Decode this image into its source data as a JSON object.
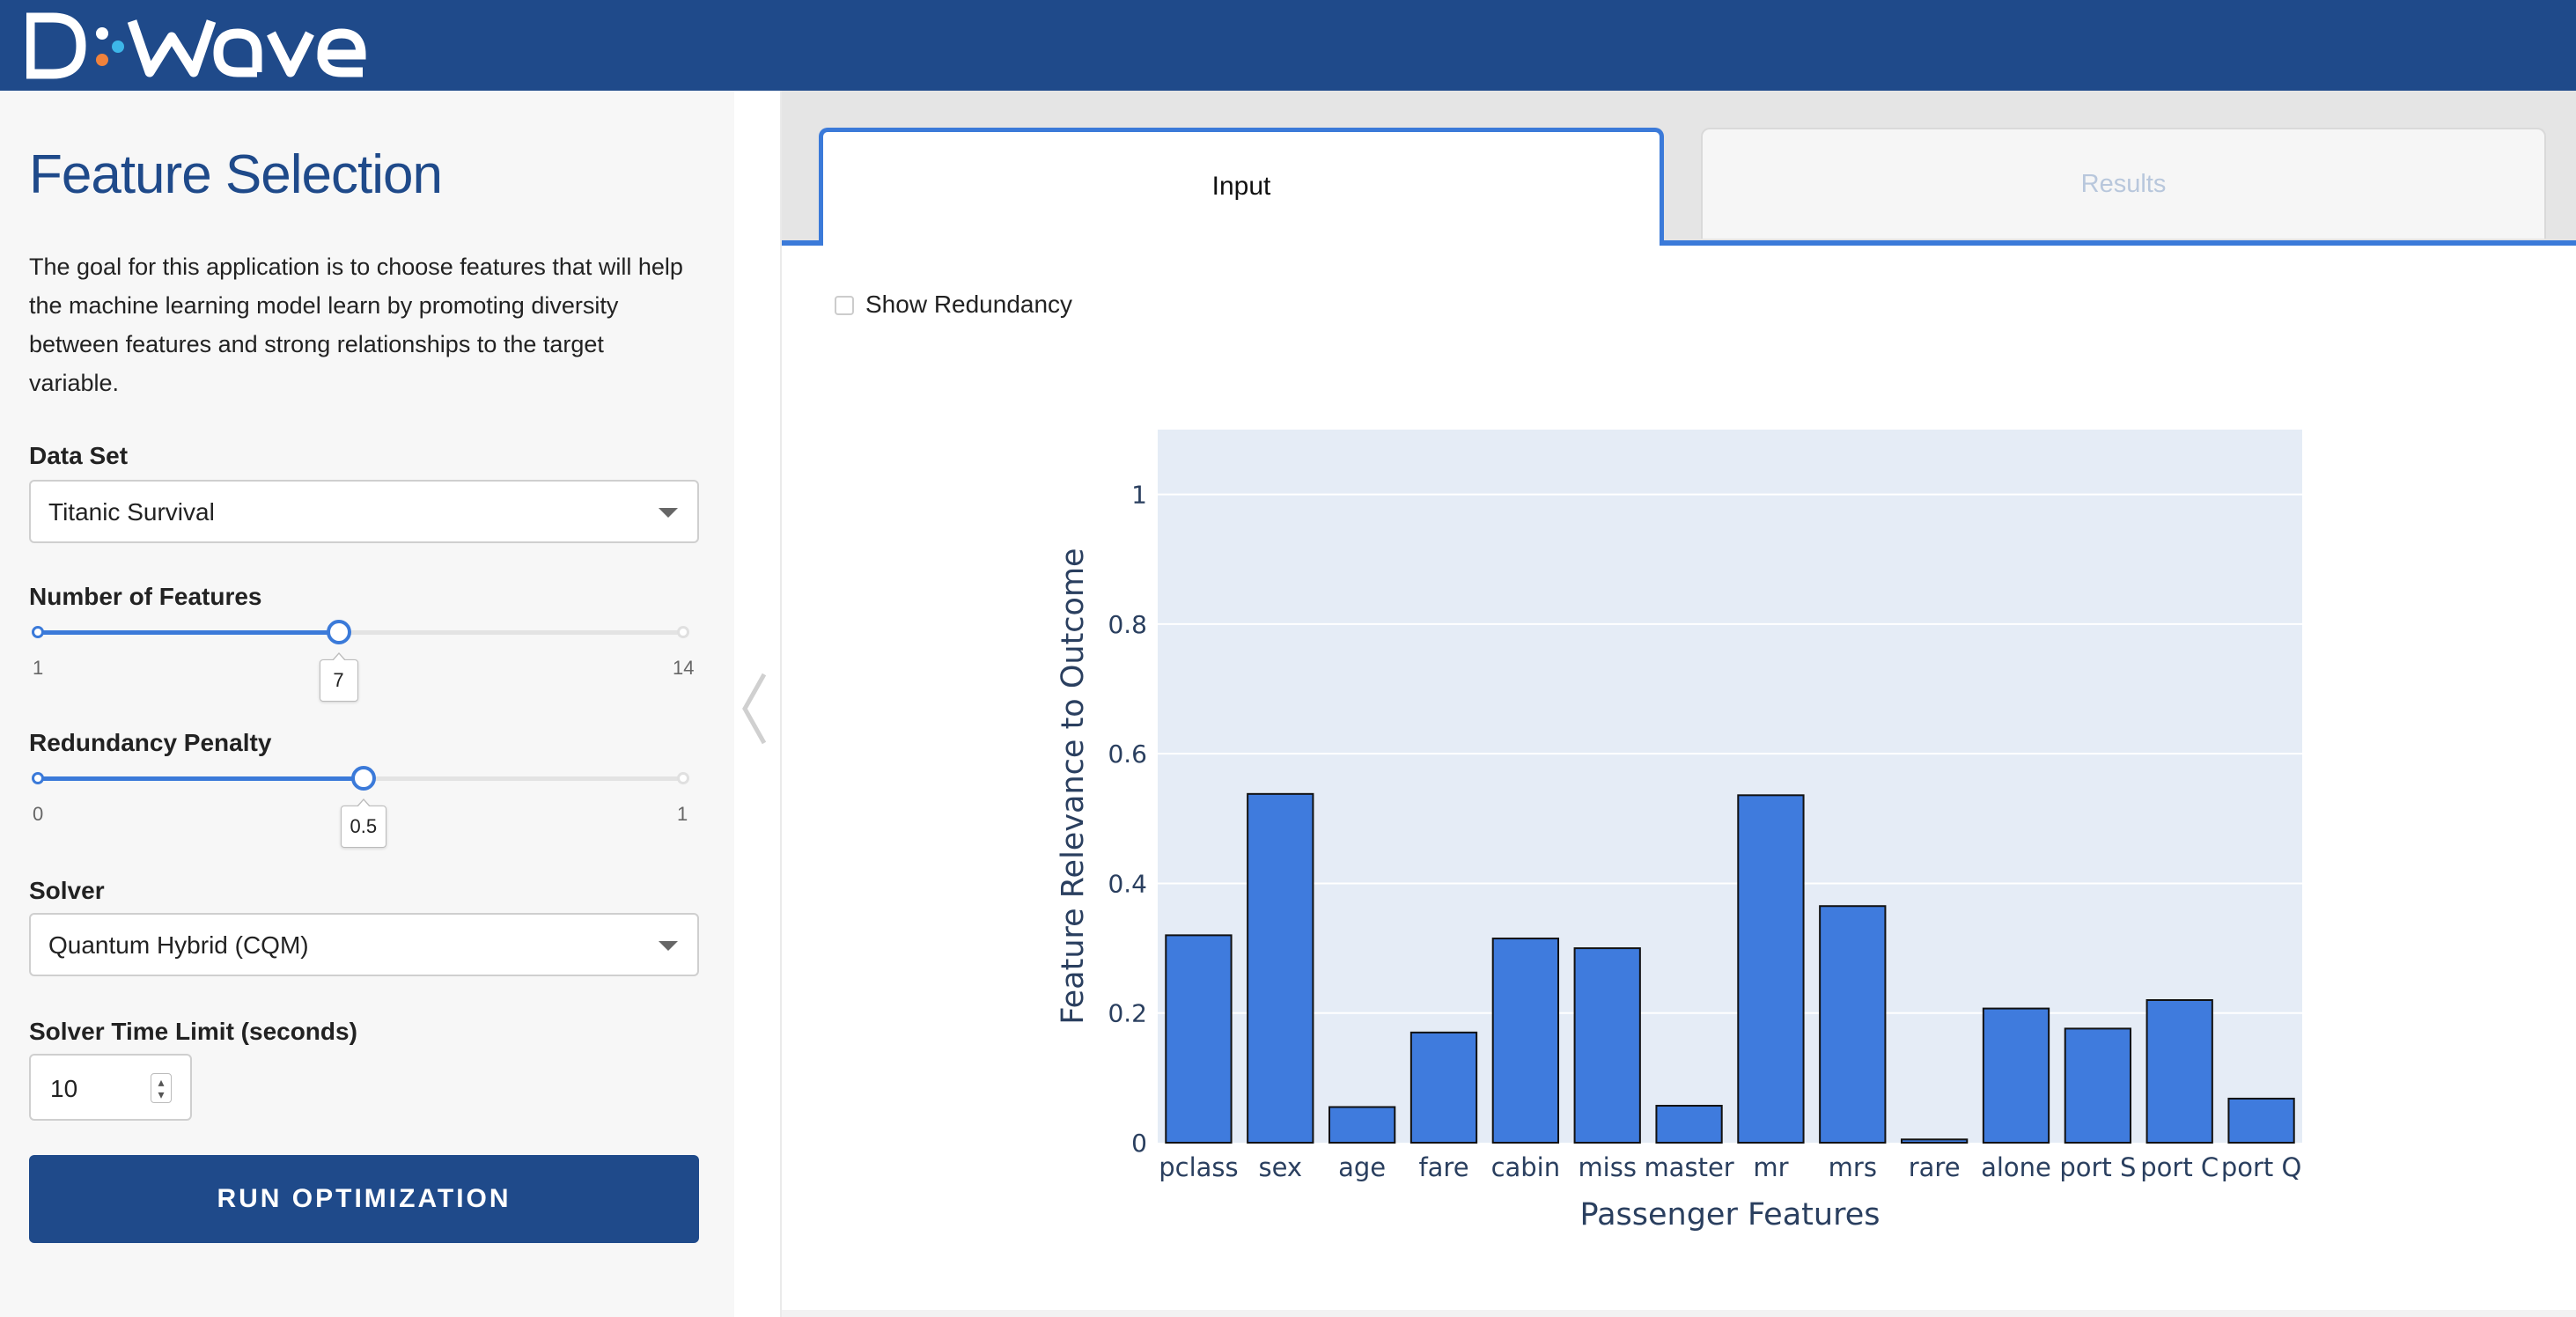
{
  "brand": {
    "logo_text": "D:WAVE",
    "header_color": "#1f4a8a"
  },
  "sidebar": {
    "title": "Feature Selection",
    "description": "The goal for this application is to choose features that will help the machine learning model learn by promoting diversity between features and strong relationships to the target variable.",
    "dataset": {
      "label": "Data Set",
      "value": "Titanic Survival"
    },
    "num_features": {
      "label": "Number of Features",
      "min": "1",
      "max": "14",
      "value": "7",
      "fraction": 0.4615
    },
    "redundancy": {
      "label": "Redundancy Penalty",
      "min": "0",
      "max": "1",
      "value": "0.5",
      "fraction": 0.5
    },
    "solver": {
      "label": "Solver",
      "value": "Quantum Hybrid (CQM)"
    },
    "time_limit": {
      "label": "Solver Time Limit (seconds)",
      "value": "10"
    },
    "run_button": "RUN OPTIMIZATION"
  },
  "tabs": {
    "input": "Input",
    "results": "Results"
  },
  "show_redundancy": {
    "label": "Show Redundancy",
    "checked": false
  },
  "accent_color": "#3b7ad9",
  "chart_data": {
    "type": "bar",
    "categories": [
      "pclass",
      "sex",
      "age",
      "fare",
      "cabin",
      "miss",
      "master",
      "mr",
      "mrs",
      "rare",
      "alone",
      "port S",
      "port C",
      "port Q"
    ],
    "values": [
      0.32,
      0.538,
      0.055,
      0.17,
      0.315,
      0.3,
      0.057,
      0.536,
      0.365,
      0.005,
      0.207,
      0.176,
      0.22,
      0.068
    ],
    "title": "",
    "xlabel": "Passenger Features",
    "ylabel": "Feature Relevance to Outcome",
    "ylim": [
      0,
      1.1
    ],
    "yticks": [
      "0",
      "0.2",
      "0.4",
      "0.6",
      "0.8",
      "1"
    ],
    "ytick_values": [
      0,
      0.2,
      0.4,
      0.6,
      0.8,
      1
    ],
    "bar_color": "#3f7bdd",
    "plot_bg": "#e5ecf6",
    "grid": true
  }
}
